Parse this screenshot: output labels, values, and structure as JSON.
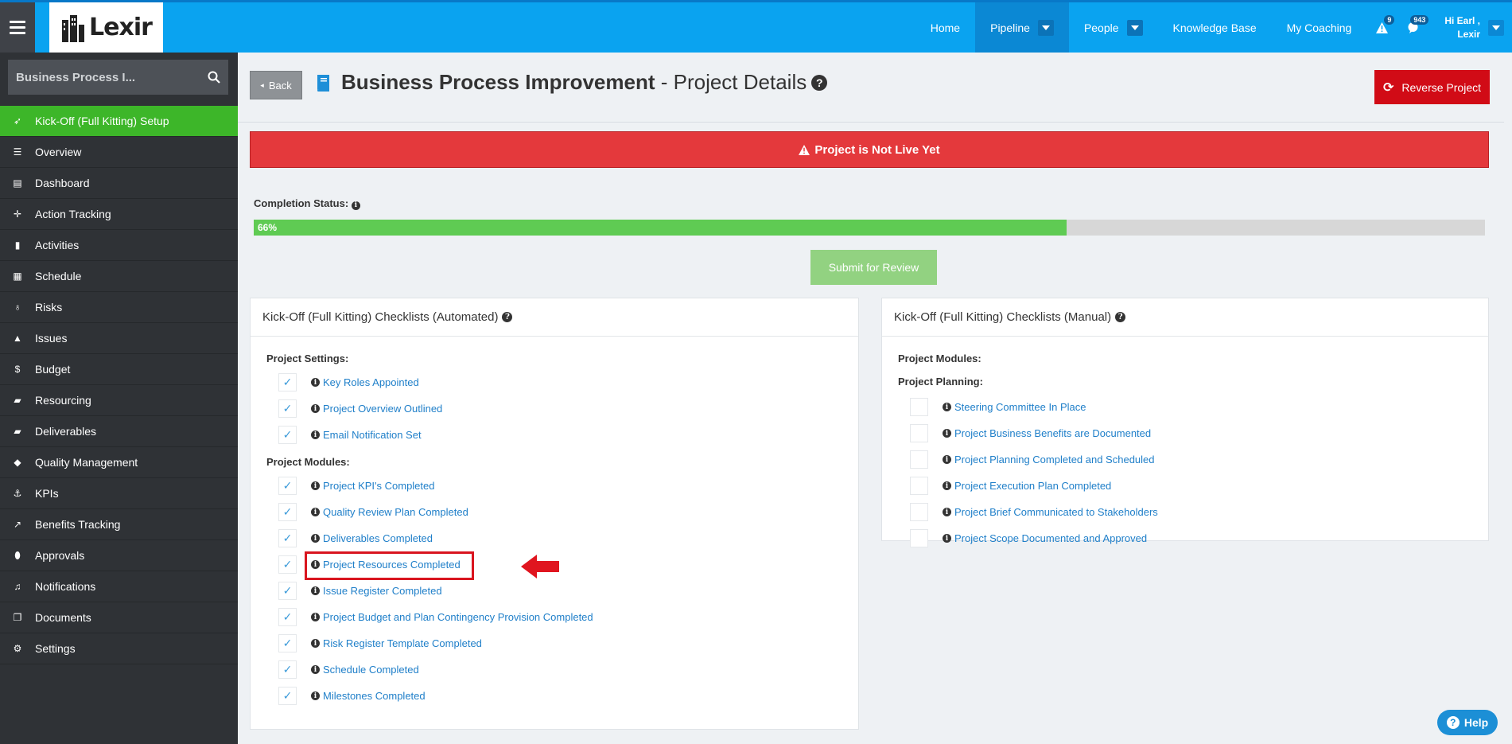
{
  "topbar": {
    "logo_text": "Lexir",
    "nav": [
      {
        "label": "Home"
      },
      {
        "label": "Pipeline"
      },
      {
        "label": "People"
      },
      {
        "label": "Knowledge Base"
      },
      {
        "label": "My Coaching"
      }
    ],
    "alerts_count": "9",
    "messages_count": "943",
    "user_greeting": "Hi Earl ,",
    "user_name": "Lexir"
  },
  "sidebar": {
    "search_value": "Business Process I...",
    "items": [
      {
        "label": "Kick-Off (Full Kitting) Setup",
        "icon": "rocket-icon"
      },
      {
        "label": "Overview",
        "icon": "list-icon"
      },
      {
        "label": "Dashboard",
        "icon": "dashboard-icon"
      },
      {
        "label": "Action Tracking",
        "icon": "crosshairs-icon"
      },
      {
        "label": "Activities",
        "icon": "bookmark-icon"
      },
      {
        "label": "Schedule",
        "icon": "calendar-icon"
      },
      {
        "label": "Risks",
        "icon": "lightbulb-icon"
      },
      {
        "label": "Issues",
        "icon": "warning-icon"
      },
      {
        "label": "Budget",
        "icon": "dollar-icon"
      },
      {
        "label": "Resourcing",
        "icon": "folder-icon"
      },
      {
        "label": "Deliverables",
        "icon": "truck-icon"
      },
      {
        "label": "Quality Management",
        "icon": "tag-icon"
      },
      {
        "label": "KPIs",
        "icon": "anchor-icon"
      },
      {
        "label": "Benefits Tracking",
        "icon": "chart-icon"
      },
      {
        "label": "Approvals",
        "icon": "pill-icon"
      },
      {
        "label": "Notifications",
        "icon": "bell-icon"
      },
      {
        "label": "Documents",
        "icon": "documents-icon"
      },
      {
        "label": "Settings",
        "icon": "gears-icon"
      }
    ]
  },
  "header": {
    "back_label": "Back",
    "title_bold": "Business Process Improvement",
    "title_rest": " - Project Details",
    "reverse_label": "Reverse Project"
  },
  "alert_text": "Project is Not Live Yet",
  "completion": {
    "label": "Completion Status:",
    "value_text": "66%",
    "value": 0.66
  },
  "submit_label": "Submit for Review",
  "automated": {
    "title": "Kick-Off (Full Kitting) Checklists (Automated)",
    "settings_title": "Project Settings:",
    "settings_items": [
      "Key Roles Appointed",
      "Project Overview Outlined",
      "Email Notification Set"
    ],
    "modules_title": "Project Modules:",
    "modules_items": [
      "Project KPI's Completed",
      "Quality Review Plan Completed",
      "Deliverables Completed",
      "Project Resources Completed",
      "Issue Register Completed",
      "Project Budget and Plan Contingency Provision Completed",
      "Risk Register Template Completed",
      "Schedule Completed",
      "Milestones Completed"
    ]
  },
  "manual": {
    "title": "Kick-Off (Full Kitting) Checklists (Manual)",
    "modules_title": "Project Modules:",
    "planning_title": "Project Planning:",
    "planning_items": [
      "Steering Committee In Place",
      "Project Business Benefits are Documented",
      "Project Planning Completed and Scheduled",
      "Project Execution Plan Completed",
      "Project Brief Communicated to Stakeholders",
      "Project Scope Documented and Approved"
    ]
  },
  "help_label": "Help",
  "colors": {
    "topbar": "#0aa3f0",
    "sidebar": "#2f3236",
    "active_menu": "#3db629",
    "alert": "#e4393c",
    "progress": "#5fcb53",
    "reverse": "#d10b16",
    "link": "#1f7fc9"
  }
}
